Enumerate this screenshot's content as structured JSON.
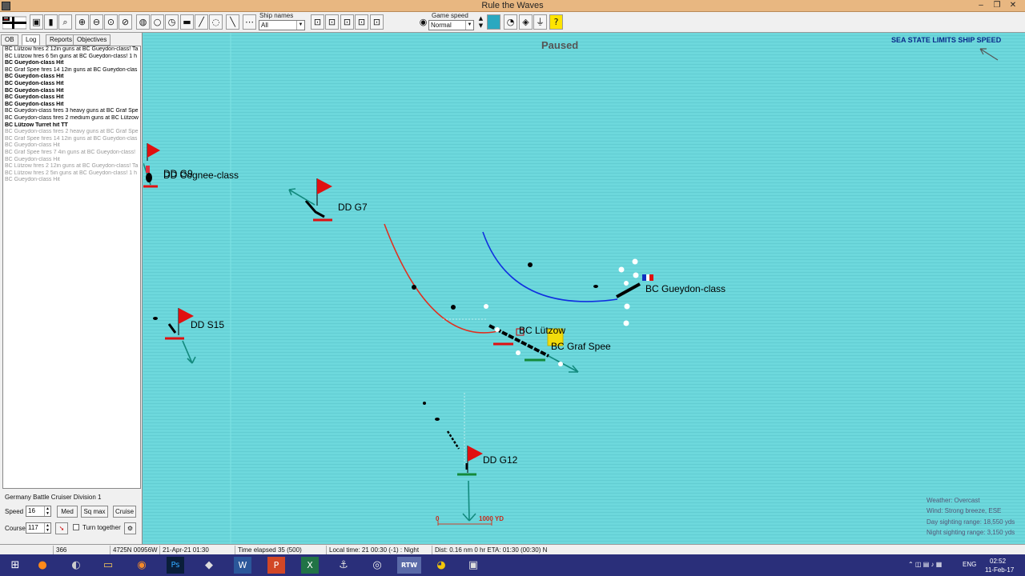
{
  "window": {
    "title": "Rule the Waves"
  },
  "toolbar": {
    "ship_names_label": "Ship names",
    "ship_names_value": "All",
    "game_speed_label": "Game speed",
    "game_speed_value": "Normal",
    "help_glyph": "?"
  },
  "left": {
    "tabs": [
      "OB",
      "Log",
      "Reports",
      "Objectives"
    ],
    "log": [
      {
        "text": "BC Lützow fires 2 12in guns at BC Gueydon-class! Ta",
        "style": "n"
      },
      {
        "text": "BC Lützow fires 6 5in guns at BC Gueydon-class! 1 h",
        "style": "n"
      },
      {
        "text": "BC Gueydon-class Hit",
        "style": "b"
      },
      {
        "text": "BC Graf Spee fires 14 12in guns at BC Gueydon-clas",
        "style": "n"
      },
      {
        "text": "BC Gueydon-class Hit",
        "style": "b"
      },
      {
        "text": "BC Gueydon-class Hit",
        "style": "b"
      },
      {
        "text": "BC Gueydon-class Hit",
        "style": "b"
      },
      {
        "text": "BC Gueydon-class Hit",
        "style": "b"
      },
      {
        "text": "BC Gueydon-class Hit",
        "style": "b"
      },
      {
        "text": "BC Gueydon-class fires 3 heavy guns at BC Graf Spe",
        "style": "n"
      },
      {
        "text": "BC Gueydon-class fires 2 medium guns at BC Lützow",
        "style": "n"
      },
      {
        "text": "BC Lützow Turret hit TT",
        "style": "b"
      },
      {
        "text": "BC Gueydon-class fires 2 heavy guns at BC Graf Spe",
        "style": "g"
      },
      {
        "text": "BC Graf Spee fires 14 12in guns at BC Gueydon-clas",
        "style": "g"
      },
      {
        "text": "BC Gueydon-class Hit",
        "style": "g"
      },
      {
        "text": "BC Graf Spee fires 7 4in guns at BC Gueydon-class!",
        "style": "g"
      },
      {
        "text": "BC Gueydon-class Hit",
        "style": "g"
      },
      {
        "text": "BC Lützow fires 2 12in guns at BC Gueydon-class! Ta",
        "style": "g"
      },
      {
        "text": "BC Lützow fires 2 5in guns at BC Gueydon-class! 1 h",
        "style": "g"
      },
      {
        "text": "BC Gueydon-class Hit",
        "style": "g"
      }
    ],
    "division": "Germany Battle Cruiser Division 1",
    "speed_label": "Speed",
    "speed_value": "16",
    "med_label": "Med",
    "sqmax_label": "Sq max",
    "cruise_label": "Cruise",
    "course_label": "Course",
    "course_value": "117",
    "turn_together_label": "Turn together"
  },
  "map": {
    "paused": "Paused",
    "sea_state": "SEA STATE LIMITS SHIP SPEED",
    "scale_zero": "0",
    "scale_end": "1000 YD",
    "weather": [
      "Weather: Overcast",
      "Wind: Strong breeze, ESE",
      "Day sighting range: 18,550 yds",
      "Night sighting range: 3,150 yds"
    ],
    "ships": {
      "dd_g9": "DD G9",
      "dd_cognee": "DD Cognee-class",
      "dd_g7": "DD G7",
      "dd_s15": "DD S15",
      "dd_g12": "DD G12",
      "bc_lutzow": "BC Lützow",
      "bc_graf_spee": "BC Graf Spee",
      "bc_gueydon": "BC Gueydon-class"
    },
    "colors": {
      "sea": "#6dd8dc",
      "german_flag": "#e01010",
      "enemy_arc": "#1030e0",
      "own_arc": "#e03020"
    }
  },
  "status": {
    "turn": "366",
    "position": "4725N 00956W",
    "date": "21-Apr-21 01:30",
    "elapsed": "Time elapsed 35 (500)",
    "local_time": "Local time: 21 00:30 (-1) : Night",
    "dist": "Dist: 0.16 nm 0 hr ETA: 01:30 (00:30) N"
  },
  "taskbar": {
    "lang": "ENG",
    "time": "02:52",
    "date": "11-Feb-17",
    "rtw_label": "RTW"
  }
}
